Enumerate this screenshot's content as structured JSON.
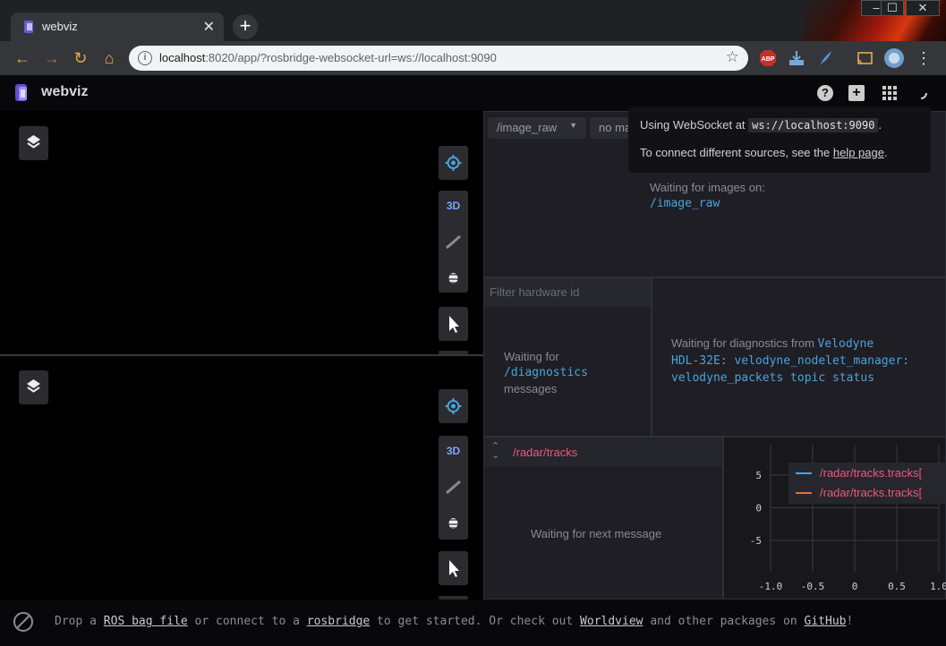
{
  "browser": {
    "tab_title": "webviz",
    "url_host": "localhost",
    "url_rest": ":8020/app/?rosbridge-websocket-url=ws://localhost:9090",
    "minimize": "–",
    "maximize": "☐",
    "close": "✕"
  },
  "app": {
    "name": "webviz"
  },
  "panel_top": {
    "control_3d": "3D"
  },
  "panel_bottom": {
    "control_3d": "3D"
  },
  "image_panel": {
    "topic_select": "/image_raw",
    "marker_select": "no ma",
    "waiting_text": "Waiting for images on:",
    "waiting_topic": "/image_raw"
  },
  "tooltip": {
    "line1_prefix": "Using WebSocket at ",
    "line1_code": "ws://localhost:9090",
    "line1_suffix": ".",
    "line2_prefix": "To connect different sources, see the ",
    "line2_link": "help page",
    "line2_suffix": "."
  },
  "diagnostics_list": {
    "filter_placeholder": "Filter hardware id",
    "waiting_1": "Waiting for",
    "waiting_topic": "/diagnostics",
    "waiting_2": "messages"
  },
  "diagnostics_detail": {
    "waiting_prefix": "Waiting for diagnostics from ",
    "source_a": "Velodyne",
    "source_b": "HDL-32E: velodyne_nodelet_manager:",
    "source_c": "velodyne_packets topic status"
  },
  "raw_messages": {
    "topic": "/radar/tracks",
    "waiting": "Waiting for next message"
  },
  "plot": {
    "legend": [
      "/radar/tracks.tracks[",
      "/radar/tracks.tracks["
    ],
    "y_ticks": [
      "5",
      "0",
      "-5"
    ],
    "x_ticks": [
      "-1.0",
      "-0.5",
      "0",
      "0.5",
      "1.0"
    ],
    "series_colors": [
      "#4aa3df",
      "#f06a3c"
    ]
  },
  "footer": {
    "t1": "Drop a ",
    "l1": "ROS bag file",
    "t2": " or connect to a ",
    "l2": "rosbridge",
    "t3": " to get started. Or check out ",
    "l3": "Worldview",
    "t4": " and other packages on ",
    "l4": "GitHub",
    "t5": "!"
  }
}
